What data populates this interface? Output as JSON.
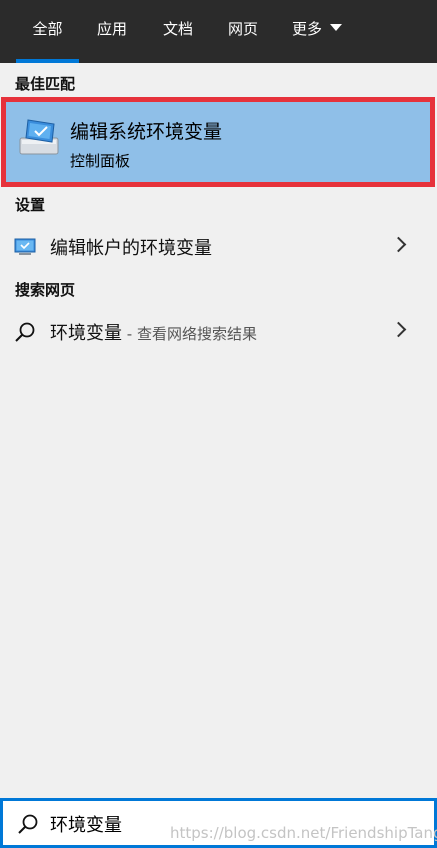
{
  "tabs": [
    {
      "label": "全部",
      "active": true
    },
    {
      "label": "应用",
      "active": false
    },
    {
      "label": "文档",
      "active": false
    },
    {
      "label": "网页",
      "active": false
    },
    {
      "label": "更多",
      "active": false
    }
  ],
  "sections": {
    "best_match": "最佳匹配",
    "settings": "设置",
    "search_web": "搜索网页"
  },
  "best_match": {
    "title": "编辑系统环境变量",
    "subtitle": "控制面板",
    "icon": "system-properties-icon"
  },
  "settings_result": {
    "label": "编辑帐户的环境变量",
    "icon": "monitor-icon"
  },
  "web_result": {
    "label": "环境变量",
    "suffix": " - 查看网络搜索结果",
    "icon": "search-icon"
  },
  "search": {
    "value": "环境变量"
  },
  "watermark": "https://blog.csdn.net/FriendshipTang",
  "colors": {
    "accent": "#0078d7",
    "highlight": "#8fbfe8",
    "annotation_border": "#e6323b",
    "top_bar": "#2b2b2b"
  }
}
